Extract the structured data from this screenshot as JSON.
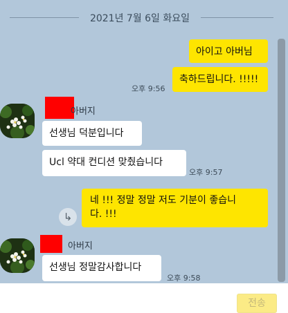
{
  "date_divider": "2021년 7월 6일 화요일",
  "messages": {
    "m1": "아이고 아버님",
    "m2": "축하드립니다. !!!!!",
    "m2_time": "오후 9:56",
    "sender1_name": "아버지",
    "m3": "선생님 덕분입니다",
    "m4": "Ucl 약대 컨디션 맞췄습니다",
    "m4_time": "오후 9:57",
    "m5_line1": "네 !!! 정말 정말 저도 기분이 좋습니",
    "m5_line2": "다. !!!",
    "sender2_name": "아버지",
    "m6": "선생님 정말감사합니다",
    "m6_time": "오후 9:58"
  },
  "input": {
    "send_label": "전송"
  },
  "icons": {
    "share": "share-arrow-icon",
    "avatar": "flower-photo-avatar"
  },
  "colors": {
    "background": "#b2c7da",
    "my_bubble": "#fee500",
    "their_bubble": "#ffffff",
    "redaction": "#ff0000"
  }
}
